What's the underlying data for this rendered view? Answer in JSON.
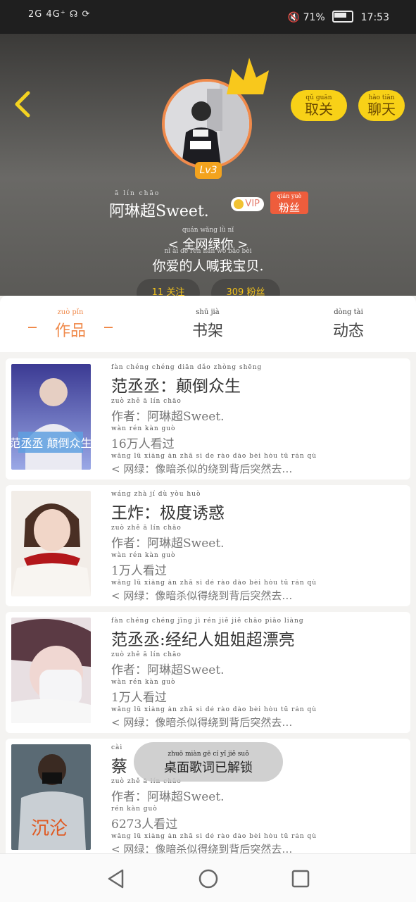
{
  "status": {
    "left": "2G 4G⁺ ☊ ⟳",
    "battery": "71%",
    "time": "17:53"
  },
  "header": {
    "back_icon": "chevron-left-icon",
    "unfollow": {
      "pinyin": "qǔ guān",
      "label": "取关"
    },
    "chat": {
      "pinyin": "hǎo tiān",
      "label": "聊天"
    },
    "level": "Lv3",
    "username_pinyin": "ā lín chāo",
    "username": "阿琳超Sweet.",
    "vip": "VIP",
    "fan_badge": {
      "pinyin": "qián yuè",
      "label": "粉丝"
    },
    "sig1_pinyin": "quán wǎng lǜ nǐ",
    "sig1": "< 全网绿你 >",
    "sig2_pinyin": "nǐ ài de rén hǎn wǒ bǎo bèi",
    "sig2": "你爱的人喊我宝贝.",
    "stat1": "11 关注",
    "stat2": "309 粉丝"
  },
  "tabs": [
    {
      "pinyin": "zuò pǐn",
      "label": "作品"
    },
    {
      "pinyin": "shū jià",
      "label": "书架"
    },
    {
      "pinyin": "dòng tài",
      "label": "动态"
    }
  ],
  "books": [
    {
      "title_py": "fàn chéng chéng  diān dǎo zhòng shēng",
      "title": "范丞丞：颠倒众生",
      "author_py": "zuò zhě  ā lín chāo",
      "author": "作者：阿琳超Sweet.",
      "views_py": "wàn rén kàn guò",
      "views": "16万人看过",
      "summary_py": "wǎng lǜ  xiàng àn zhā sì de rào dào bèi hòu tū rán qù",
      "summary": "< 网绿：像暗杀似的绕到背后突然去…",
      "cover_text": "范丞丞 颠倒众生"
    },
    {
      "title_py": "wáng zhà  jí dù yòu huò",
      "title": "王炸：极度诱惑",
      "author_py": "zuò zhě  ā lín chāo",
      "author": "作者：阿琳超Sweet.",
      "views_py": "wàn rén kàn guò",
      "views": "1万人看过",
      "summary_py": "wǎng lǜ  xiàng àn zhā sì dé rào dào bèi hòu tū rán qù",
      "summary": "< 网绿：像暗杀似得绕到背后突然去…",
      "cover_text": ""
    },
    {
      "title_py": "fàn chéng chéng jīng jì rén jiě jiě chāo piāo liàng",
      "title": "范丞丞:经纪人姐姐超漂亮",
      "author_py": "zuò zhě  ā lín chāo",
      "author": "作者：阿琳超Sweet.",
      "views_py": "wàn rén kàn guò",
      "views": "1万人看过",
      "summary_py": "wǎng lǜ  xiàng àn zhā sì dé rào dào bèi hòu tū rán qù",
      "summary": "< 网绿：像暗杀似得绕到背后突然去…",
      "cover_text": ""
    },
    {
      "title_py": "cài",
      "title": "蔡",
      "author_py": "zuò zhě  ā lín chāo",
      "author": "作者：阿琳超Sweet.",
      "views_py": "rén kàn guò",
      "views": "6273人看过",
      "summary_py": "wǎng lǜ  xiàng àn zhā sì dé rào dào bèi hòu tū rán qù",
      "summary": "< 网绿：像暗杀似得绕到背后突然去…",
      "cover_text": "沉沦"
    }
  ],
  "toast": {
    "pinyin": "zhuō miàn gē cí yǐ jiě suǒ",
    "label": "桌面歌词已解锁"
  },
  "colors": {
    "accent": "#f08a4b",
    "pill": "#f8d117",
    "fan": "#ee5d3c"
  }
}
